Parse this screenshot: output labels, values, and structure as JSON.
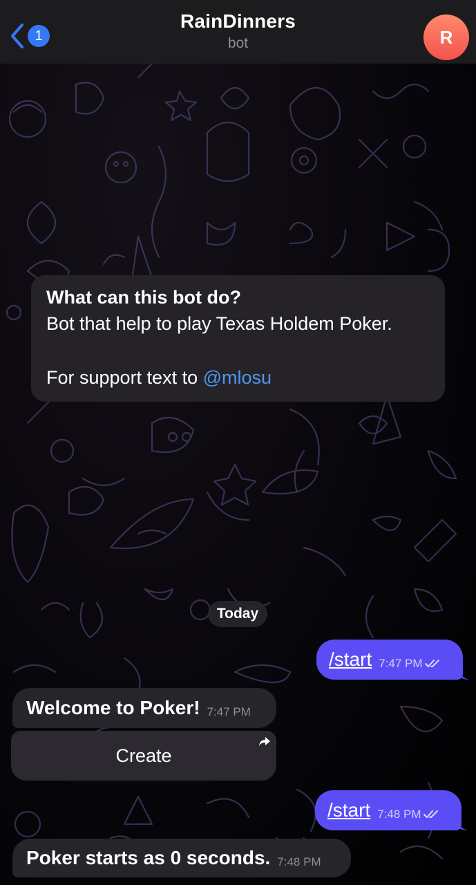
{
  "header": {
    "back_count": "1",
    "title": "RainDinners",
    "subtitle": "bot",
    "avatar_letter": "R",
    "avatar_color": "#f4524e"
  },
  "info_card": {
    "title": "What can this bot do?",
    "description": "Bot that help to play Texas Holdem Poker.",
    "support_prefix": "For support text to ",
    "support_mention": "@mlosu"
  },
  "date_separator": "Today",
  "messages": [
    {
      "direction": "out",
      "text": "/start",
      "time": "7:47 PM",
      "status": "read"
    },
    {
      "direction": "in",
      "text": "Welcome to Poker!",
      "time": "7:47 PM"
    },
    {
      "direction": "in",
      "type": "inline-button",
      "text": "Create"
    },
    {
      "direction": "out",
      "text": "/start",
      "time": "7:48 PM",
      "status": "read"
    },
    {
      "direction": "in",
      "text": "Poker starts as 0 seconds.",
      "time": "7:48 PM"
    }
  ],
  "colors": {
    "accent": "#3478f6",
    "outgoing_bubble": "#5b4df6",
    "incoming_bubble": "#28262c",
    "mention": "#4f95f1"
  }
}
